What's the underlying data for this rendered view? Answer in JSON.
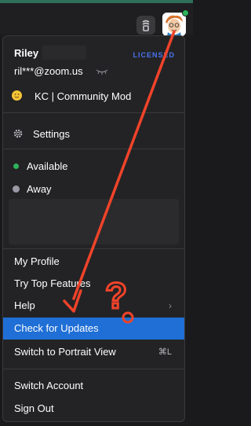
{
  "header": {
    "user_name": "Riley",
    "license_badge": "LICENSED",
    "email": "ril***@zoom.us",
    "status_message": "KC | Community Mod"
  },
  "menu": {
    "settings_label": "Settings",
    "presence": {
      "available_label": "Available",
      "away_label": "Away"
    },
    "items": [
      {
        "label": "My Profile"
      },
      {
        "label": "Try Top Features"
      },
      {
        "label": "Help",
        "has_submenu": true
      },
      {
        "label": "Check for Updates",
        "highlighted": true
      },
      {
        "label": "Switch to Portrait View",
        "shortcut": "⌘L"
      },
      {
        "label": "Switch Account"
      },
      {
        "label": "Sign Out"
      }
    ]
  },
  "annotation": {
    "question_mark": "?"
  },
  "colors": {
    "highlight": "#1f6fd6",
    "license_badge": "#4a74f0",
    "available": "#2fb35b",
    "annotation_red": "#f0432a"
  },
  "icons": [
    "shield-icon",
    "avatar",
    "eyelash-icon",
    "emoji-icon",
    "gear-icon",
    "available-dot-icon",
    "away-moon-icon",
    "chevron-right-icon"
  ]
}
